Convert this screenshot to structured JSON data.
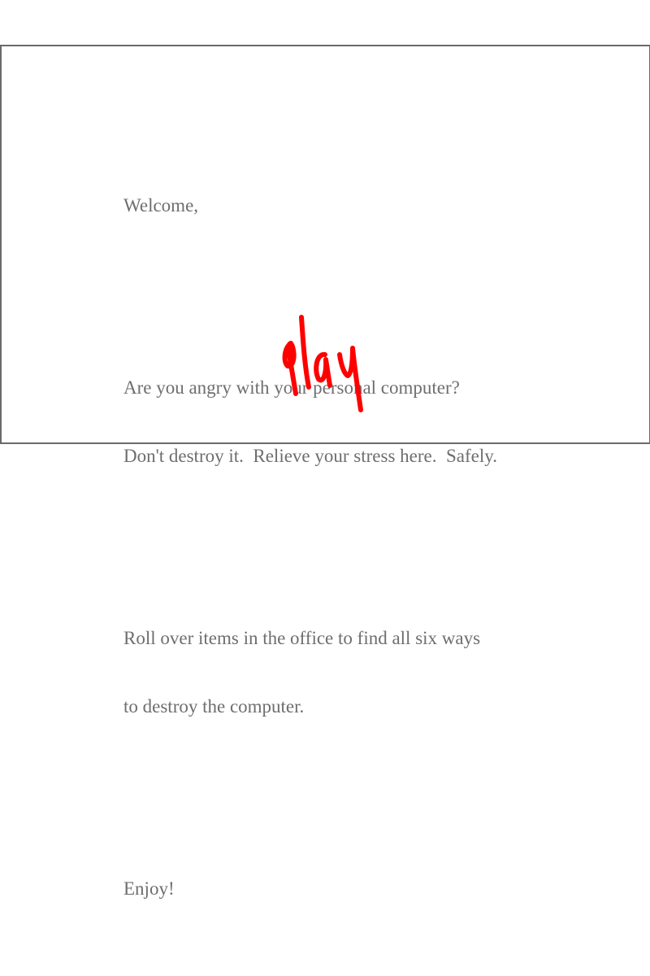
{
  "intro": {
    "greeting": "Welcome,",
    "line1": "Are you angry with your personal computer?",
    "line2": "Don't destroy it.  Relieve your stress here.  Safely.",
    "line3": "Roll over items in the office to find all six ways",
    "line4": "to destroy the computer.",
    "closing": "Enjoy!"
  },
  "play_button": {
    "label": "play",
    "color": "#ff0000"
  },
  "colors": {
    "text": "#6e6e6e",
    "border": "#6a6a6a",
    "background": "#ffffff"
  }
}
